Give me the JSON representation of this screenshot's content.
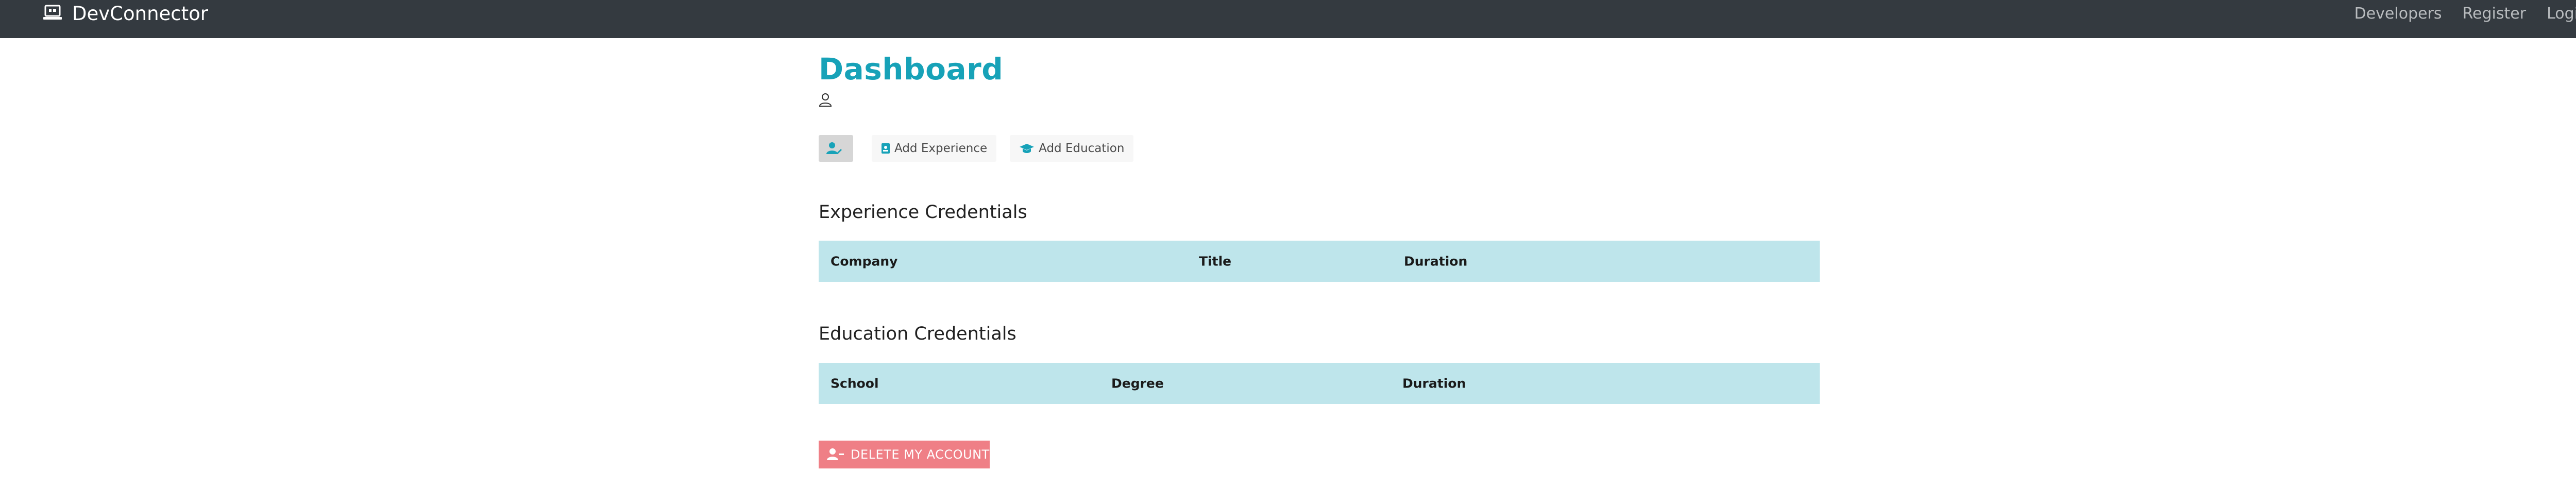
{
  "navbar": {
    "brand_icon": "laptop-code-icon",
    "brand": "DevConnector",
    "links": [
      "Developers",
      "Register",
      "Login"
    ]
  },
  "page": {
    "title": "Dashboard",
    "user_icon": "user-icon"
  },
  "actions": {
    "edit_profile_icon": "user-edit-icon",
    "add_experience": "Add Experience",
    "add_experience_icon": "id-badge-icon",
    "add_education": "Add Education",
    "add_education_icon": "graduation-cap-icon"
  },
  "experience": {
    "heading": "Experience Credentials",
    "columns": [
      "Company",
      "Title",
      "Duration"
    ],
    "rows": []
  },
  "education": {
    "heading": "Education Credentials",
    "columns": [
      "School",
      "Degree",
      "Duration"
    ],
    "rows": []
  },
  "delete_account": {
    "label": "DELETE MY ACCOUNT",
    "icon": "user-minus-icon"
  },
  "colors": {
    "navbar": "#343a40",
    "primary": "#17a2b8",
    "table_header": "#bee5eb",
    "danger": "#ef7f86"
  }
}
